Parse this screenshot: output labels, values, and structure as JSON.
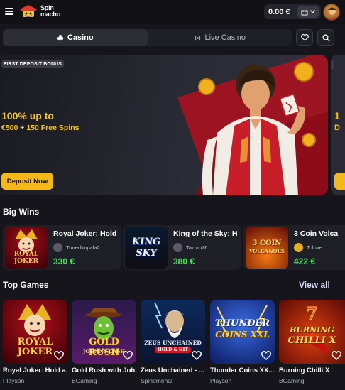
{
  "header": {
    "logo_line1": "Spin",
    "logo_line2": "macho",
    "balance": "0.00 €"
  },
  "tabs": [
    {
      "label": "Casino",
      "icon": "club-icon",
      "active": true
    },
    {
      "label": "Live Casino",
      "icon": "live-icon",
      "active": false
    }
  ],
  "banner": {
    "tag": "FIRST DEPOSIT BONUS",
    "headline": "100% up to",
    "subline": "€500 + 150 Free Spins",
    "cta": "Deposit Now"
  },
  "big_wins": {
    "title": "Big Wins",
    "items": [
      {
        "game": "Royal Joker: Hold",
        "user": "TunedImpala2",
        "amount": "330 €",
        "art_line1": "ROYAL",
        "art_line2": "JOKER"
      },
      {
        "game": "King of the Sky: H",
        "user": "Tazmo76",
        "amount": "380 €",
        "art_line1": "KING",
        "art_line2": "SKY"
      },
      {
        "game": "3 Coin Volca",
        "user": "Tolove",
        "amount": "422 €",
        "art_line1": "3 COIN",
        "art_line2": "VOLCANOES"
      }
    ]
  },
  "top_games": {
    "title": "Top Games",
    "view_all": "View all",
    "items": [
      {
        "name": "Royal Joker: Hold a...",
        "provider": "Playson",
        "art_line1": "ROYAL",
        "art_line2": "JOKER"
      },
      {
        "name": "Gold Rush with Joh...",
        "provider": "BGaming",
        "art_line1": "GOLD RUSH",
        "art_line2": "JOHNNY CASH"
      },
      {
        "name": "Zeus Unchained - ...",
        "provider": "Spinomenal",
        "art_line1": "ZEUS UNCHAINED",
        "art_line2": "HOLD & HIT"
      },
      {
        "name": "Thunder Coins XX...",
        "provider": "Playson",
        "art_line1": "THUNDER",
        "art_line2": "COINS XXL"
      },
      {
        "name": "Burning Chilli X",
        "provider": "BGaming",
        "art_line1": "BURNING",
        "art_line2": "CHILLI X"
      }
    ]
  },
  "colors": {
    "accent": "#f5b81c",
    "win_green": "#4ce35a",
    "background": "#15151b"
  }
}
